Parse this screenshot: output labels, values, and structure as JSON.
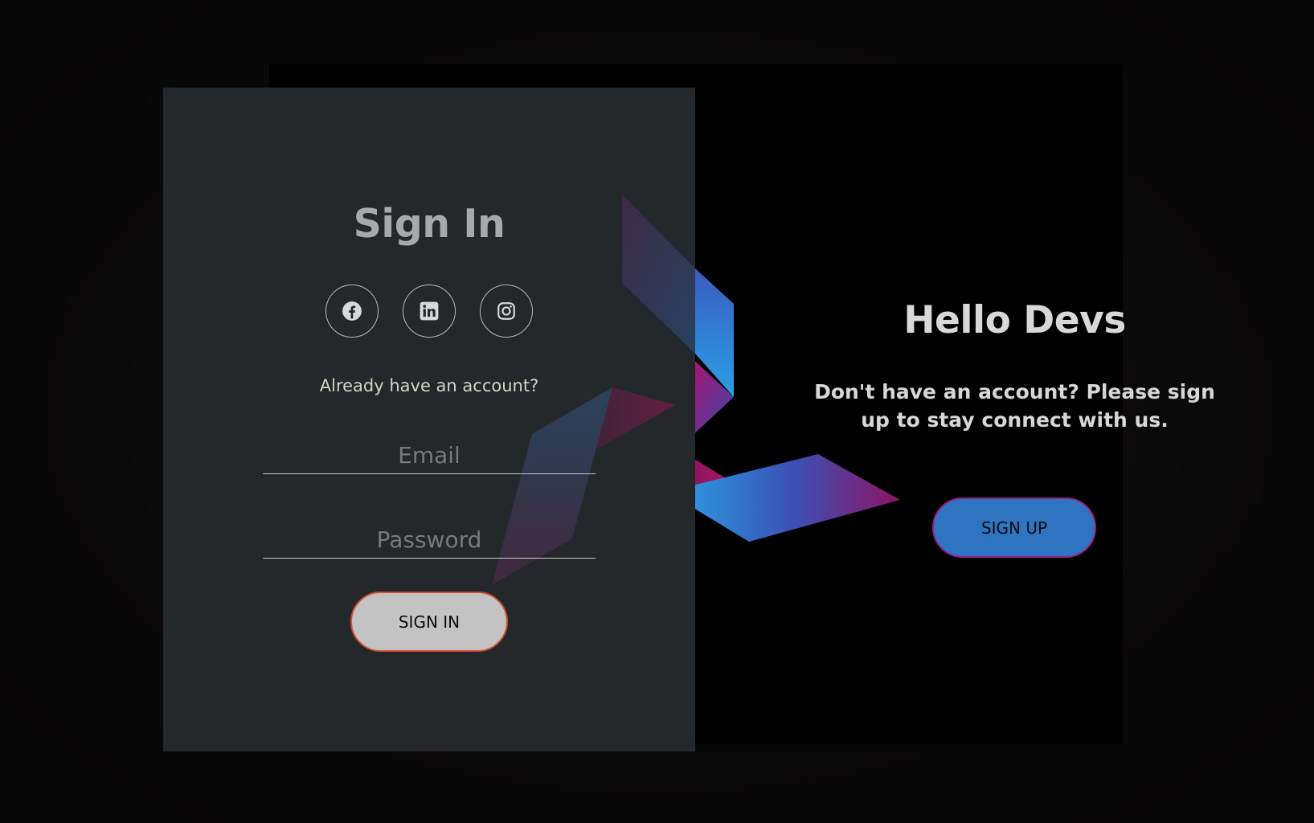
{
  "signin": {
    "title": "Sign In",
    "social": [
      {
        "icon": "facebook-icon"
      },
      {
        "icon": "linkedin-icon"
      },
      {
        "icon": "instagram-icon"
      }
    ],
    "prompt": "Already have an account?",
    "email_placeholder": "Email",
    "password_placeholder": "Password",
    "button_label": "SIGN IN"
  },
  "signup": {
    "title": "Hello Devs",
    "text": "Don't have an account? Please sign up to stay connect with us.",
    "button_label": "SIGN UP"
  },
  "colors": {
    "left_panel": "#24282b",
    "right_panel": "#000000",
    "signin_button": "#c3c3c3",
    "signin_border": "#cf4c36",
    "signup_button": "#2f74c1",
    "signup_border": "#9b1f8a",
    "accent_blue": "#2f9ee0",
    "accent_magenta": "#8a1a6e"
  }
}
